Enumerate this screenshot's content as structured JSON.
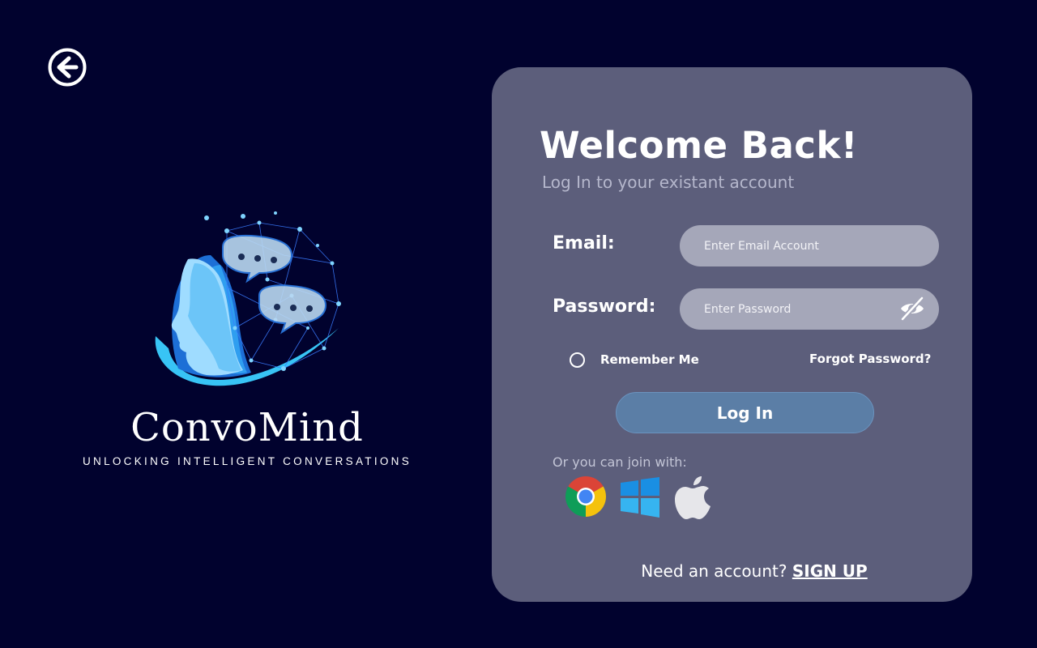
{
  "brand": {
    "name": "ConvoMind",
    "tagline": "UNLOCKING INTELLIGENT CONVERSATIONS"
  },
  "login": {
    "title": "Welcome Back!",
    "subtitle": "Log In to your existant  account",
    "email_label": "Email:",
    "email_placeholder": "Enter Email Account",
    "password_label": "Password:",
    "password_placeholder": "Enter Password",
    "remember_label": "Remember Me",
    "forgot_label": "Forgot Password?",
    "login_button": "Log In",
    "join_text": "Or you can join with:",
    "signup_prompt": "Need an account?",
    "signup_link": "SIGN UP"
  },
  "icons": {
    "back": "back-arrow-icon",
    "password_toggle": "eye-slash-icon",
    "social": [
      "chrome-icon",
      "windows-icon",
      "apple-icon"
    ]
  },
  "colors": {
    "background": "#01022e",
    "card": "#5c5e7b",
    "input": "#a5a7b9",
    "button": "#5b7ea6",
    "logo_accent": "#38c4f5"
  }
}
